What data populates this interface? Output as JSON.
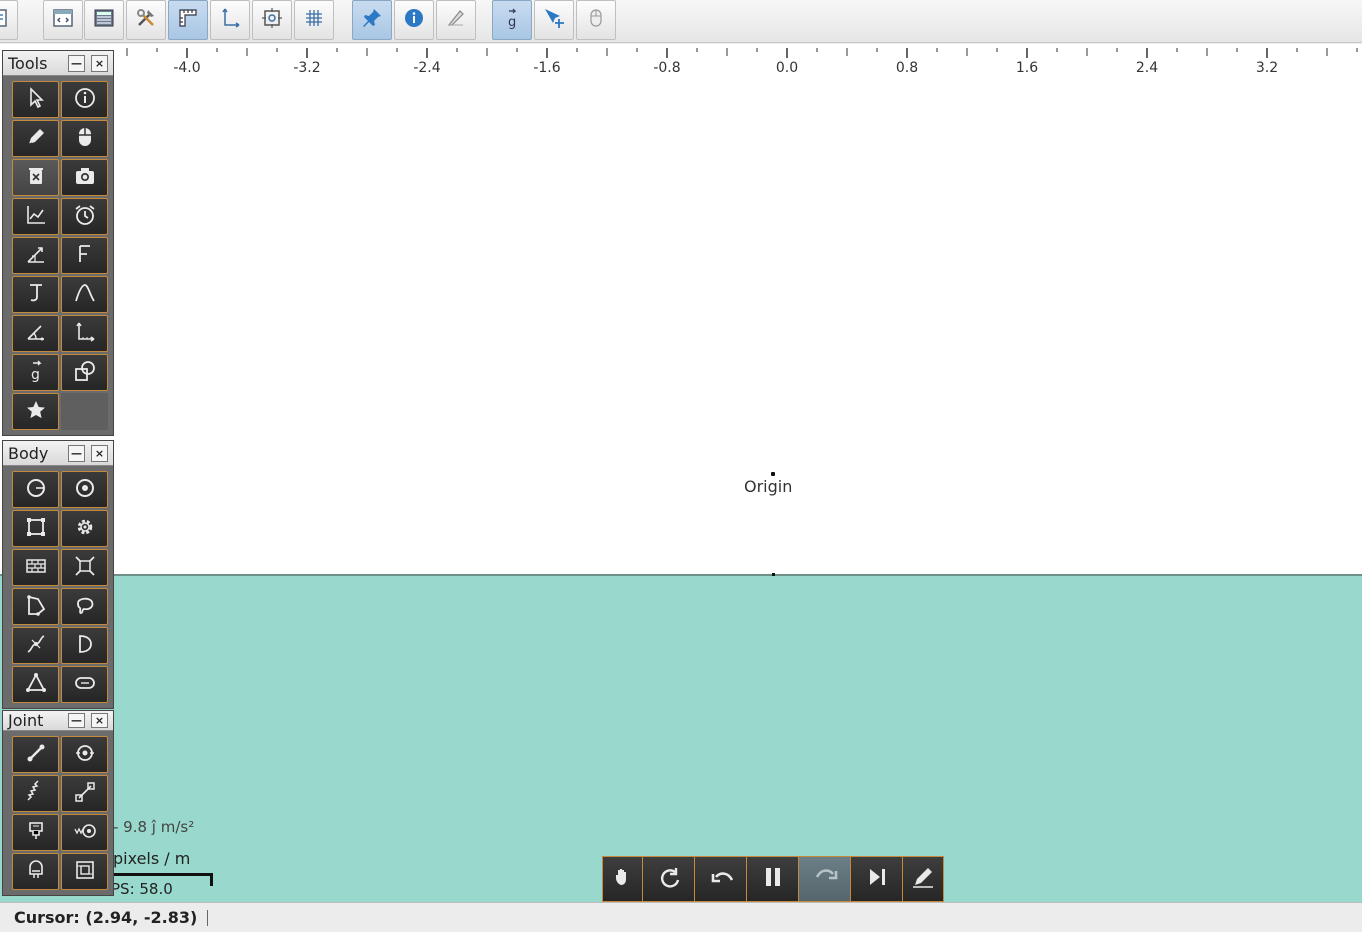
{
  "toolbar": {
    "buttons": [
      {
        "name": "properties-icon",
        "on": false
      },
      {
        "name": "code-window-icon",
        "on": false
      },
      {
        "name": "calculator-icon",
        "on": false
      },
      {
        "name": "tools-icon",
        "on": false
      },
      {
        "name": "ruler-icon",
        "on": true
      },
      {
        "name": "axes-icon",
        "on": false
      },
      {
        "name": "camera-follow-icon",
        "on": false
      },
      {
        "name": "grid-icon",
        "on": false
      },
      {
        "name": "pin-icon",
        "on": true
      },
      {
        "name": "info-icon",
        "on": true
      },
      {
        "name": "eraser-icon",
        "on": false
      },
      {
        "name": "gravity-vector-icon",
        "on": true
      },
      {
        "name": "move-cursor-icon",
        "on": false
      },
      {
        "name": "mouse-icon",
        "on": false
      }
    ]
  },
  "ruler": {
    "ticks": [
      "-4.0",
      "-3.2",
      "-2.4",
      "-1.6",
      "-0.8",
      "0.0",
      "0.8",
      "1.6",
      "2.4",
      "3.2"
    ]
  },
  "world": {
    "origin_label": "Origin",
    "gravity": "- 9.8 ĵ m/s²",
    "scale": "pixels / m",
    "fps": "PS: 58.0"
  },
  "palettes": {
    "tools": {
      "title": "Tools",
      "items": [
        "select-icon",
        "info-icon",
        "pencil-icon",
        "mouse-icon",
        "delete-icon",
        "camera-icon",
        "graph-icon",
        "alarm-clock-icon",
        "vector-icon",
        "force-icon",
        "impulse-icon",
        "path-icon",
        "angle-icon",
        "axes-icon",
        "gravity-icon",
        "shape-icon",
        "star-icon"
      ]
    },
    "body": {
      "title": "Body",
      "items": [
        "circle-icon",
        "ring-icon",
        "box-icon",
        "gear-icon",
        "wall-icon",
        "ragdoll-icon",
        "polygon-icon",
        "blob-icon",
        "spline-icon",
        "half-circle-icon",
        "triangle-icon",
        "capsule-icon"
      ]
    },
    "joint": {
      "title": "Joint",
      "items": [
        "rod-joint-icon",
        "pivot-joint-icon",
        "spring-joint-icon",
        "slider-joint-icon",
        "motor-joint-icon",
        "wheel-joint-icon",
        "weld-joint-icon",
        "group-joint-icon"
      ]
    }
  },
  "playback": {
    "buttons": [
      "hand-icon",
      "reset-icon",
      "undo-icon",
      "pause-icon",
      "redo-icon",
      "step-icon",
      "edit-icon"
    ]
  },
  "status": {
    "cursor": "Cursor: (2.94, -2.83)"
  }
}
